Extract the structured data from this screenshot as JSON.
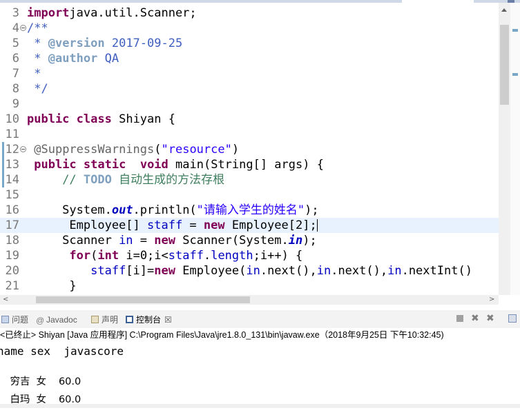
{
  "editor": {
    "lines": [
      {
        "n": "3",
        "fold": false,
        "html": [
          [
            "kw",
            "import"
          ],
          [
            "",
            "java.util.Scanner;"
          ]
        ]
      },
      {
        "n": "4",
        "fold": true,
        "html": [
          [
            "cm",
            "/**"
          ]
        ]
      },
      {
        "n": "5",
        "fold": false,
        "html": [
          [
            "cm",
            " * "
          ],
          [
            "tag",
            "@version"
          ],
          [
            "cm",
            " 2017-09-25"
          ]
        ]
      },
      {
        "n": "6",
        "fold": false,
        "html": [
          [
            "cm",
            " * "
          ],
          [
            "tag",
            "@author"
          ],
          [
            "cm",
            " QA"
          ]
        ]
      },
      {
        "n": "7",
        "fold": false,
        "html": [
          [
            "cm",
            " *"
          ]
        ]
      },
      {
        "n": "8",
        "fold": false,
        "html": [
          [
            "cm",
            " */"
          ]
        ]
      },
      {
        "n": "9",
        "fold": false,
        "html": []
      },
      {
        "n": "10",
        "fold": false,
        "html": [
          [
            "kw",
            "public"
          ],
          [
            "",
            " "
          ],
          [
            "kw",
            "class"
          ],
          [
            "",
            " Shiyan {"
          ]
        ]
      },
      {
        "n": "11",
        "fold": false,
        "html": []
      },
      {
        "n": "12",
        "fold": true,
        "html": [
          [
            "",
            " "
          ],
          [
            "ann",
            "@SuppressWarnings"
          ],
          [
            "",
            "("
          ],
          [
            "str",
            "\"resource\""
          ],
          [
            "",
            ")"
          ]
        ]
      },
      {
        "n": "13",
        "fold": false,
        "html": [
          [
            "",
            " "
          ],
          [
            "kw",
            "public"
          ],
          [
            "",
            " "
          ],
          [
            "kw",
            "static"
          ],
          [
            "",
            "  "
          ],
          [
            "kw",
            "void"
          ],
          [
            "",
            " main(String[] args) {"
          ]
        ]
      },
      {
        "n": "14",
        "fold": false,
        "html": [
          [
            "",
            "     "
          ],
          [
            "lc",
            "// "
          ],
          [
            "todo",
            "TODO"
          ],
          [
            "lc",
            " 自动生成的方法存根"
          ]
        ]
      },
      {
        "n": "15",
        "fold": false,
        "html": []
      },
      {
        "n": "16",
        "fold": false,
        "html": [
          [
            "",
            "     System."
          ],
          [
            "sfld",
            "out"
          ],
          [
            "",
            ".println("
          ],
          [
            "str",
            "\"请输入学生的姓名\""
          ],
          [
            "",
            ");"
          ]
        ]
      },
      {
        "n": "17",
        "fold": false,
        "current": true,
        "html": [
          [
            "",
            "      Employee[] "
          ],
          [
            "fld",
            "staff"
          ],
          [
            "",
            " = "
          ],
          [
            "kw",
            "new"
          ],
          [
            "",
            " Employee[2];"
          ],
          [
            "caret",
            ""
          ]
        ]
      },
      {
        "n": "18",
        "fold": false,
        "html": [
          [
            "",
            "     Scanner "
          ],
          [
            "fld",
            "in"
          ],
          [
            "",
            " = "
          ],
          [
            "kw",
            "new"
          ],
          [
            "",
            " Scanner(System."
          ],
          [
            "sfld",
            "in"
          ],
          [
            "",
            ");"
          ]
        ]
      },
      {
        "n": "19",
        "fold": false,
        "html": [
          [
            "",
            "      "
          ],
          [
            "kw",
            "for"
          ],
          [
            "",
            "("
          ],
          [
            "kw",
            "int"
          ],
          [
            "",
            " i=0;i<"
          ],
          [
            "fld",
            "staff"
          ],
          [
            "",
            "."
          ],
          [
            "fld",
            "length"
          ],
          [
            "",
            ";i++) {"
          ]
        ]
      },
      {
        "n": "20",
        "fold": false,
        "html": [
          [
            "",
            "         "
          ],
          [
            "fld",
            "staff"
          ],
          [
            "",
            "[i]="
          ],
          [
            "kw",
            "new"
          ],
          [
            "",
            " Employee("
          ],
          [
            "fld",
            "in"
          ],
          [
            "",
            ".next(),"
          ],
          [
            "fld",
            "in"
          ],
          [
            "",
            ".next(),"
          ],
          [
            "fld",
            "in"
          ],
          [
            "",
            ".nextInt()"
          ]
        ]
      },
      {
        "n": "21",
        "fold": false,
        "html": [
          [
            "",
            "      }"
          ]
        ]
      }
    ]
  },
  "panel": {
    "tabs": [
      {
        "label": "问题",
        "name": "tab-problems"
      },
      {
        "label": "Javadoc",
        "name": "tab-javadoc"
      },
      {
        "label": "声明",
        "name": "tab-declaration"
      },
      {
        "label": "控制台",
        "name": "tab-console"
      }
    ],
    "close_glyph": "☒",
    "status": "<已终止> Shiyan [Java 应用程序] C:\\Program Files\\Java\\jre1.8.0_131\\bin\\javaw.exe（2018年9月25日 下午10:32:45)"
  },
  "console": {
    "header": "name sex  javascore",
    "rows": [
      {
        "name": "穷吉",
        "sex": "女",
        "score": "60.0"
      },
      {
        "name": "白玛",
        "sex": "女",
        "score": "60.0"
      }
    ]
  },
  "hscroll": {
    "left": "<",
    "right": ">"
  }
}
